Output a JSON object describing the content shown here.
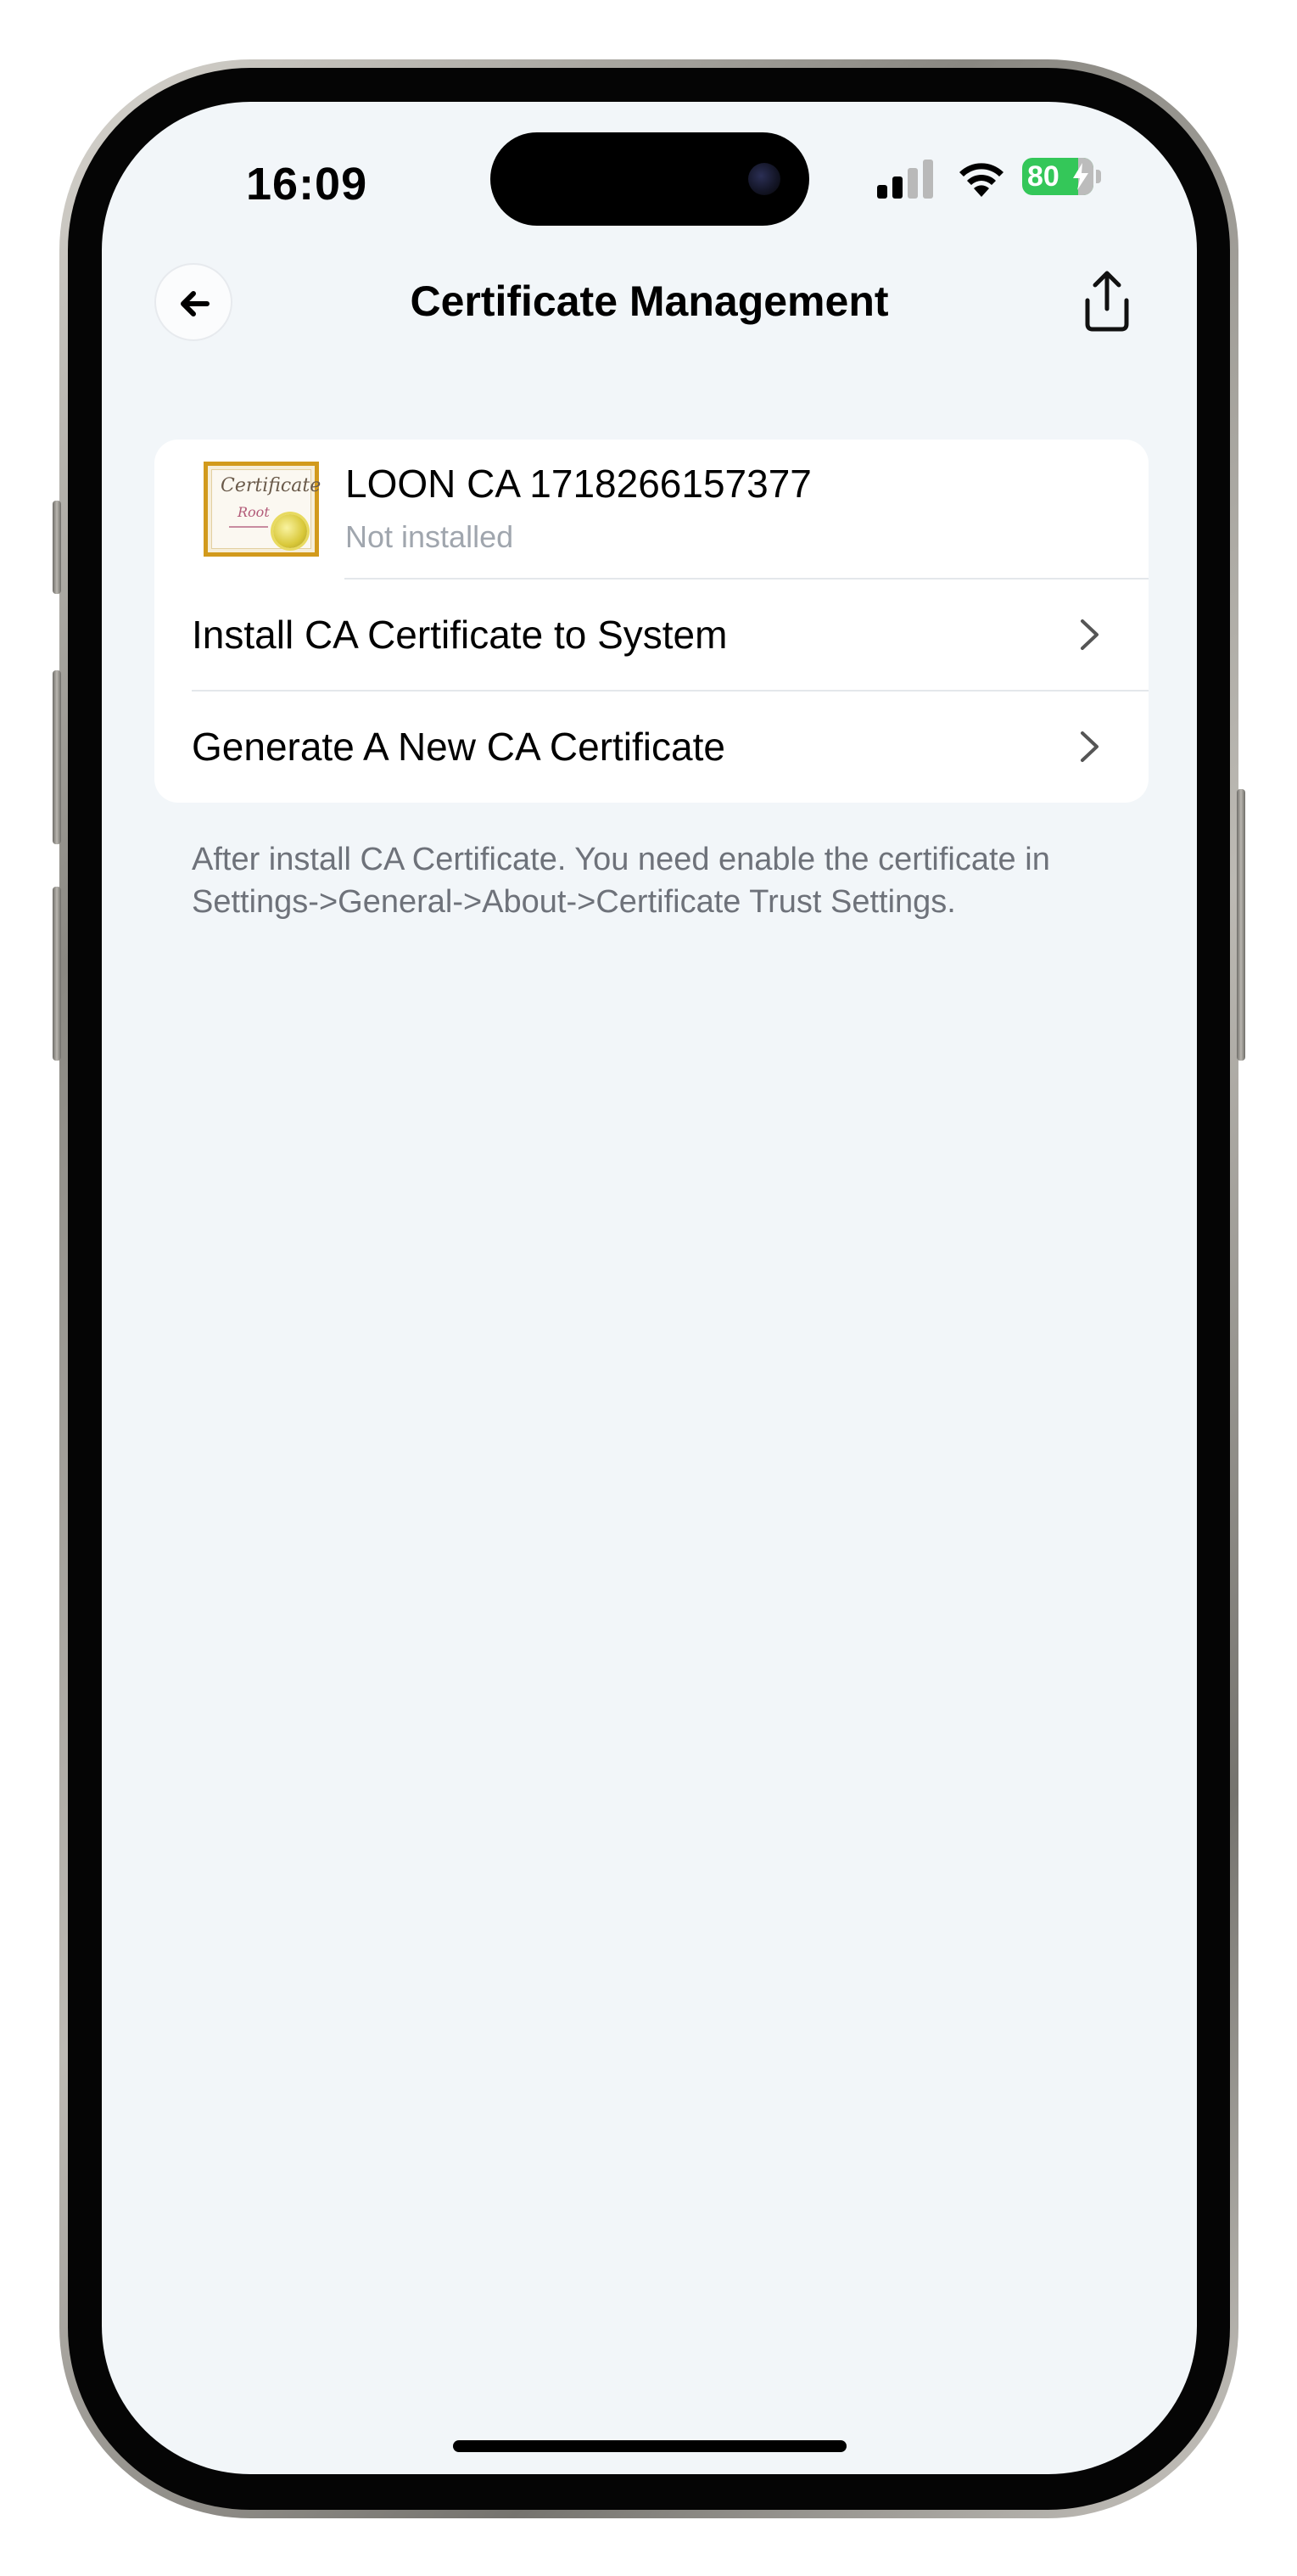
{
  "status_bar": {
    "time": "16:09",
    "battery": "80"
  },
  "nav": {
    "title": "Certificate Management",
    "back_icon": "arrow-left-icon",
    "share_icon": "share-icon"
  },
  "certificate": {
    "name": "LOON CA 1718266157377",
    "status": "Not installed",
    "icon_text_1": "Certificate",
    "icon_text_2": "Root"
  },
  "actions": [
    {
      "label": "Install CA Certificate to System"
    },
    {
      "label": "Generate A New CA Certificate"
    }
  ],
  "note": "After install CA Certificate. You need enable the certificate in Settings->General->About->Certificate Trust Settings.",
  "colors": {
    "background": "#f2f6f9",
    "card": "#ffffff",
    "battery": "#34c759",
    "secondary_text": "#6e727a"
  }
}
